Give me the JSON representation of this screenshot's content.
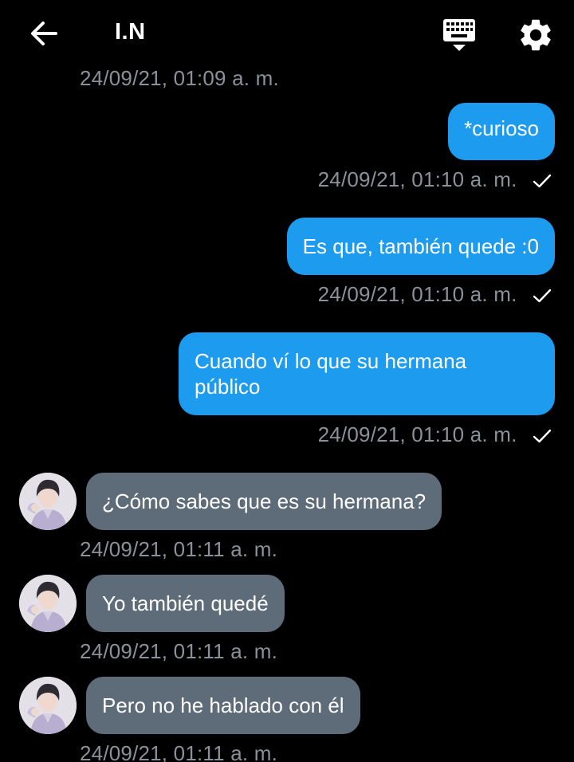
{
  "header": {
    "title": "I.N"
  },
  "messages": {
    "top_timestamp": "24/09/21, 01:09 a. m.",
    "m1": {
      "text": "*curioso",
      "time": "24/09/21, 01:10 a. m."
    },
    "m2": {
      "text": "Es que, también quede :0",
      "time": "24/09/21, 01:10 a. m."
    },
    "m3": {
      "line1": "Cuando ví lo que su hermana",
      "line2": "público",
      "time": "24/09/21, 01:10 a. m."
    },
    "m4": {
      "text": "¿Cómo sabes que es su hermana?",
      "time": "24/09/21, 01:11 a. m."
    },
    "m5": {
      "text": "Yo también quedé",
      "time": "24/09/21, 01:11 a. m."
    },
    "m6": {
      "text": "Pero no he hablado con él",
      "time": "24/09/21, 01:11 a. m."
    }
  },
  "colors": {
    "background": "#000000",
    "outgoing_bubble": "#1c9bef",
    "incoming_bubble": "#5e6b78",
    "timestamp": "#8a919b",
    "text": "#ffffff"
  },
  "icons": [
    "arrow-left-icon",
    "keyboard-icon",
    "gear-icon",
    "checkmark-icon",
    "avatar"
  ]
}
